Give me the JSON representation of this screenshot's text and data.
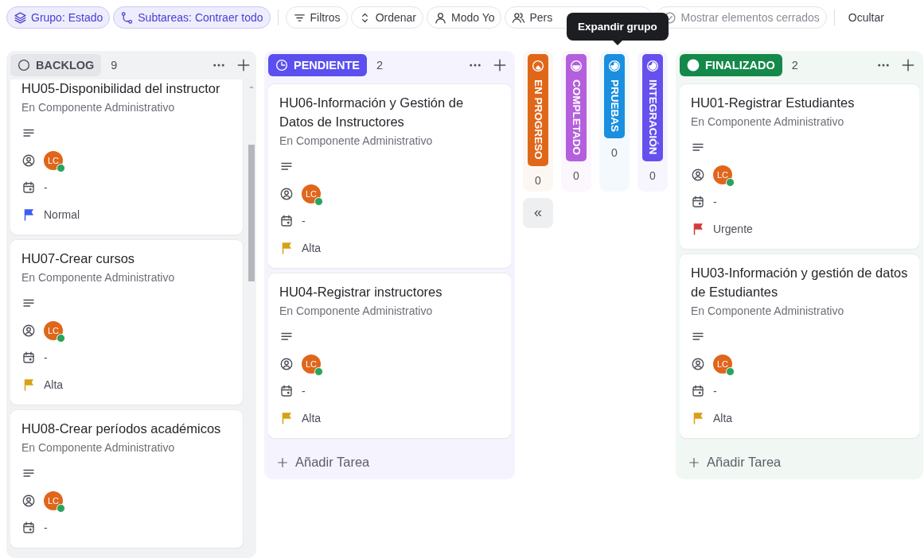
{
  "toolbar": {
    "chips": [
      {
        "label": "Grupo: Estado",
        "active": true,
        "disabled": false
      },
      {
        "label": "Subtareas: Contraer todo",
        "active": true,
        "disabled": false
      },
      {
        "label": "Filtros",
        "active": false,
        "disabled": false
      },
      {
        "label": "Ordenar",
        "active": false,
        "disabled": false
      },
      {
        "label": "Modo Yo",
        "active": false,
        "disabled": false
      },
      {
        "label": "Pers",
        "active": false,
        "disabled": false
      },
      {
        "label": "Mostrar elementos cerrados",
        "active": false,
        "disabled": true
      }
    ],
    "hide_button": "Ocultar"
  },
  "tooltip": {
    "text": "Expandir grupo"
  },
  "columns": [
    {
      "name": "BACKLOG",
      "count": "9",
      "collapsed": false,
      "color": "#e5e6e9",
      "cards": [
        {
          "title": "HU05-Disponibilidad del instructor",
          "list": "En Componente Administrativo",
          "assignee": "LC",
          "online": true,
          "date": "-",
          "priority": {
            "label": "Normal",
            "color": "#3d5cf5"
          }
        },
        {
          "title": "HU07-Crear cursos",
          "list": "En Componente Administrativo",
          "assignee": "LC",
          "online": true,
          "date": "-",
          "priority": {
            "label": "Alta",
            "color": "#d9a016"
          }
        },
        {
          "title": "HU08-Crear períodos académicos",
          "list": "En Componente Administrativo",
          "assignee": "LC",
          "online": true,
          "date": "-"
        }
      ]
    },
    {
      "name": "PENDIENTE",
      "count": "2",
      "collapsed": false,
      "color": "#5b4ff0",
      "add_task": "Añadir Tarea",
      "cards": [
        {
          "title": "HU06-Información y Gestión de Datos de Instructores",
          "list": "En Componente Administrativo",
          "assignee": "LC",
          "online": true,
          "date": "-",
          "priority": {
            "label": "Alta",
            "color": "#d9a016"
          }
        },
        {
          "title": "HU04-Registrar instructores",
          "list": "En Componente Administrativo",
          "assignee": "LC",
          "online": true,
          "date": "-",
          "priority": {
            "label": "Alta",
            "color": "#d9a016"
          }
        }
      ]
    },
    {
      "name": "EN PROGRESO",
      "count": "0",
      "collapsed": true,
      "color": "#e0671a"
    },
    {
      "name": "COMPLETADO",
      "count": "0",
      "collapsed": true,
      "color": "#b45fdc"
    },
    {
      "name": "PRUEBAS",
      "count": "0",
      "collapsed": true,
      "color": "#1a8fe0"
    },
    {
      "name": "INTEGRACIÓN",
      "count": "0",
      "collapsed": true,
      "color": "#6550ee"
    },
    {
      "name": "FINALIZADO",
      "count": "2",
      "collapsed": false,
      "color": "#14894a",
      "add_task": "Añadir Tarea",
      "cards": [
        {
          "title": "HU01-Registrar Estudiantes",
          "list": "En Componente Administrativo",
          "assignee": "LC",
          "online": true,
          "date": "-",
          "priority": {
            "label": "Urgente",
            "color": "#d23b3b"
          }
        },
        {
          "title": "HU03-Información y gestión de datos de Estudiantes",
          "list": "En Componente Administrativo",
          "assignee": "LC",
          "online": true,
          "date": "-",
          "priority": {
            "label": "Alta",
            "color": "#d9a016"
          }
        }
      ]
    }
  ],
  "collapse_button": "«"
}
